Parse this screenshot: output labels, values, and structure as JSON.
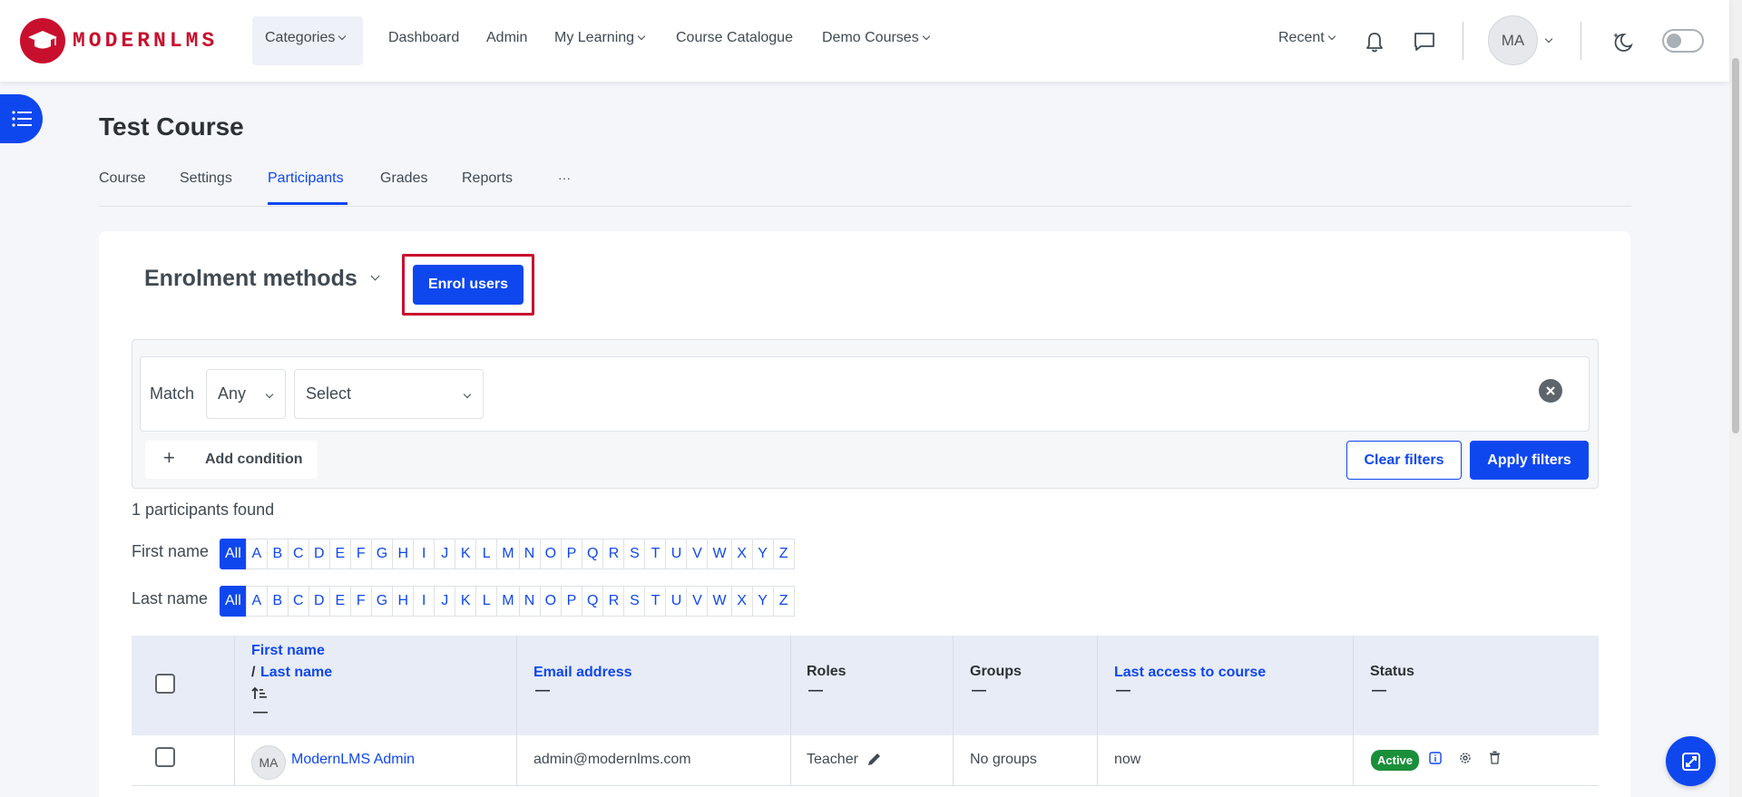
{
  "navbar": {
    "brand": "MODERNLMS",
    "items": [
      {
        "label": "Categories"
      },
      {
        "label": "Dashboard"
      },
      {
        "label": "Admin"
      },
      {
        "label": "My Learning"
      },
      {
        "label": "Course Catalogue"
      },
      {
        "label": "Demo Courses"
      }
    ],
    "recent": "Recent",
    "user_initials": "MA"
  },
  "page": {
    "title": "Test Course",
    "tabs": [
      "Course",
      "Settings",
      "Participants",
      "Grades",
      "Reports",
      "···"
    ],
    "active_tab": "Participants"
  },
  "enrol": {
    "heading": "Enrolment methods",
    "button": "Enrol users"
  },
  "filters": {
    "match_label": "Match",
    "match_value": "Any",
    "select_value": "Select",
    "add_condition": "Add condition",
    "clear": "Clear filters",
    "apply": "Apply filters"
  },
  "results": {
    "found": "1 participants found",
    "first_name_label": "First name",
    "last_name_label": "Last name",
    "letters": [
      "All",
      "A",
      "B",
      "C",
      "D",
      "E",
      "F",
      "G",
      "H",
      "I",
      "J",
      "K",
      "L",
      "M",
      "N",
      "O",
      "P",
      "Q",
      "R",
      "S",
      "T",
      "U",
      "V",
      "W",
      "X",
      "Y",
      "Z"
    ]
  },
  "table": {
    "headers": {
      "first_name": "First name",
      "slash": "/",
      "last_name": "Last name",
      "email": "Email address",
      "roles": "Roles",
      "groups": "Groups",
      "last_access": "Last access to course",
      "status": "Status",
      "dash": "—"
    },
    "rows": [
      {
        "initials": "MA",
        "name": "ModernLMS Admin",
        "email": "admin@modernlms.com",
        "role": "Teacher",
        "groups": "No groups",
        "last_access": "now",
        "status": "Active"
      }
    ]
  },
  "colors": {
    "primary": "#0f47ef",
    "brand": "#c8102e",
    "success": "#1a8f3a"
  }
}
